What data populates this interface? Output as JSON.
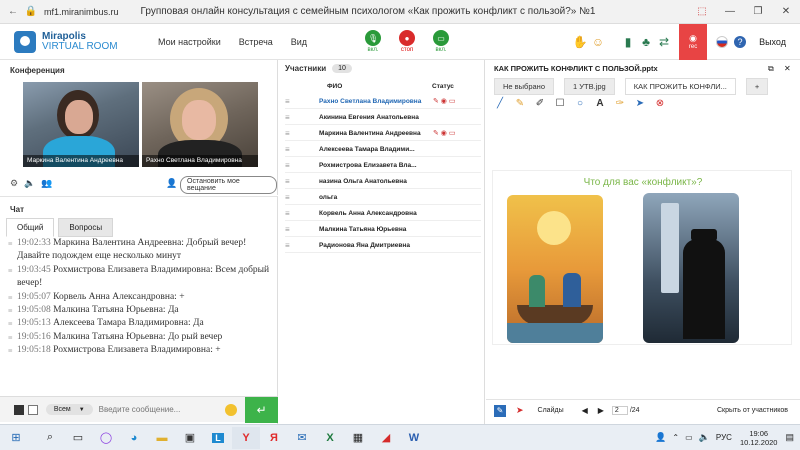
{
  "browser": {
    "url": "mf1.miranimbus.ru",
    "title": "Групповая онлайн консультация с семейным психологом «Как прожить конфликт с пользой?» №1"
  },
  "header": {
    "logo_line1": "Mirapolis",
    "logo_line2": "VIRTUAL ROOM",
    "menu": [
      "Мои настройки",
      "Встреча",
      "Вид"
    ],
    "mic_label": "вкл.",
    "stop_label": "стоп",
    "cam_label": "вкл.",
    "rec_label": "rec",
    "exit_label": "Выход"
  },
  "conference": {
    "title": "Конференция",
    "videos": [
      {
        "name": "Маркина Валентина  Андреевна"
      },
      {
        "name": "Рахно Светлана  Владимировна"
      }
    ],
    "stop_broadcast": "Остановить мое вещание"
  },
  "chat": {
    "title": "Чат",
    "tabs": [
      "Общий",
      "Вопросы"
    ],
    "messages": [
      {
        "time": "19:02:33",
        "text": "Маркина Валентина  Андреевна: Добрый вечер! Давайте подождем еще несколько минут"
      },
      {
        "time": "19:03:45",
        "text": "Рохмистрова  Елизавета Владимировна: Всем добрый вечер!"
      },
      {
        "time": "19:05:07",
        "text": "Корвель Анна  Александровна: +"
      },
      {
        "time": "19:05:08",
        "text": "Малкина Татьяна  Юрьевна: Да"
      },
      {
        "time": "19:05:13",
        "text": "Алексеева   Тамара  Владимировна: Да"
      },
      {
        "time": "19:05:16",
        "text": "Малкина Татьяна  Юрьевна: До рый вечер"
      },
      {
        "time": "19:05:18",
        "text": "Рохмистрова  Елизавета Владимировна: +"
      }
    ],
    "recipient": "Всем",
    "input_placeholder": "Введите сообщение..."
  },
  "participants": {
    "title": "Участники",
    "count": "10",
    "col_name": "ФИО",
    "col_status": "Статус",
    "list": [
      "Рахно Светлана  Владимировна",
      "Акинина  Евгения Анатольевна",
      "Маркина Валентина  Андреевна",
      "Алексеева   Тамара  Владими...",
      "Рохмистрова  Елизавета Вла...",
      "назина  Ольга Анатольевна",
      "ольга",
      "Корвель Анна  Александровна",
      "Малкина Татьяна  Юрьевна",
      "Радионова Яна  Дмитриевна"
    ]
  },
  "presentation": {
    "title": "КАК ПРОЖИТЬ КОНФЛИКТ С ПОЛЬЗОЙ.pptx",
    "tabs": [
      "Не выбрано",
      "1 УТВ.jpg",
      "КАК ПРОЖИТЬ КОНФЛИ..."
    ],
    "add_tab": "+",
    "slide_heading": "Что для вас «конфликт»?",
    "slides_label": "Слайды",
    "page_current": "2",
    "page_total": "/24",
    "hide_label": "Скрыть от участников"
  },
  "taskbar": {
    "lang": "РУС",
    "time": "19:06",
    "date": "10.12.2020"
  }
}
